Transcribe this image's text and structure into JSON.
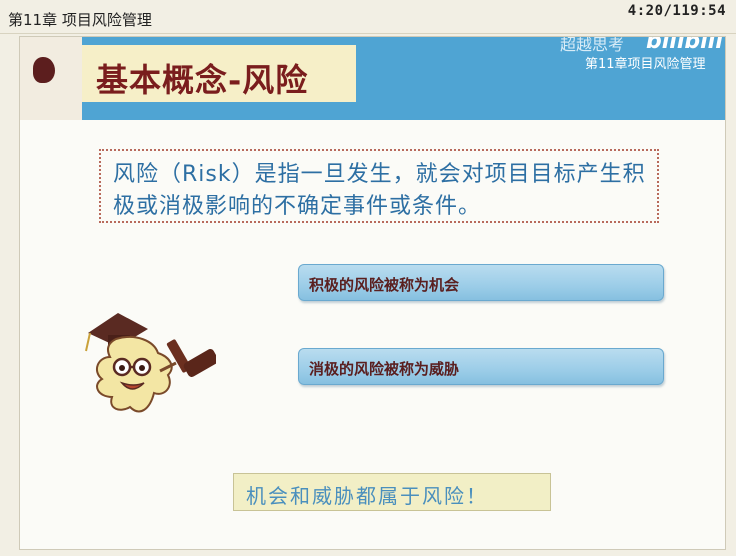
{
  "window": {
    "title": "第11章 项目风险管理",
    "timer": "4:20/119:54"
  },
  "header": {
    "slide_title": "基本概念-风险",
    "watermark": "超越思考",
    "brand": "bilibili",
    "subtitle": "第11章项目风险管理"
  },
  "content": {
    "definition": "风险（Risk）是指一旦发生，就会对项目目标产生积极或消极影响的不确定事件或条件。",
    "positive": "积极的风险被称为机会",
    "negative": "消极的风险被称为威胁",
    "conclusion": "机会和威胁都属于风险！"
  },
  "colors": {
    "header_blue": "#4fa4d3",
    "title_maroon": "#7a1d1d",
    "definition_text": "#2d6fa3",
    "pill_blue": "#9ccde8"
  },
  "icons": {
    "logo": "logo-icon",
    "mascot": "mascot-judge-icon"
  }
}
